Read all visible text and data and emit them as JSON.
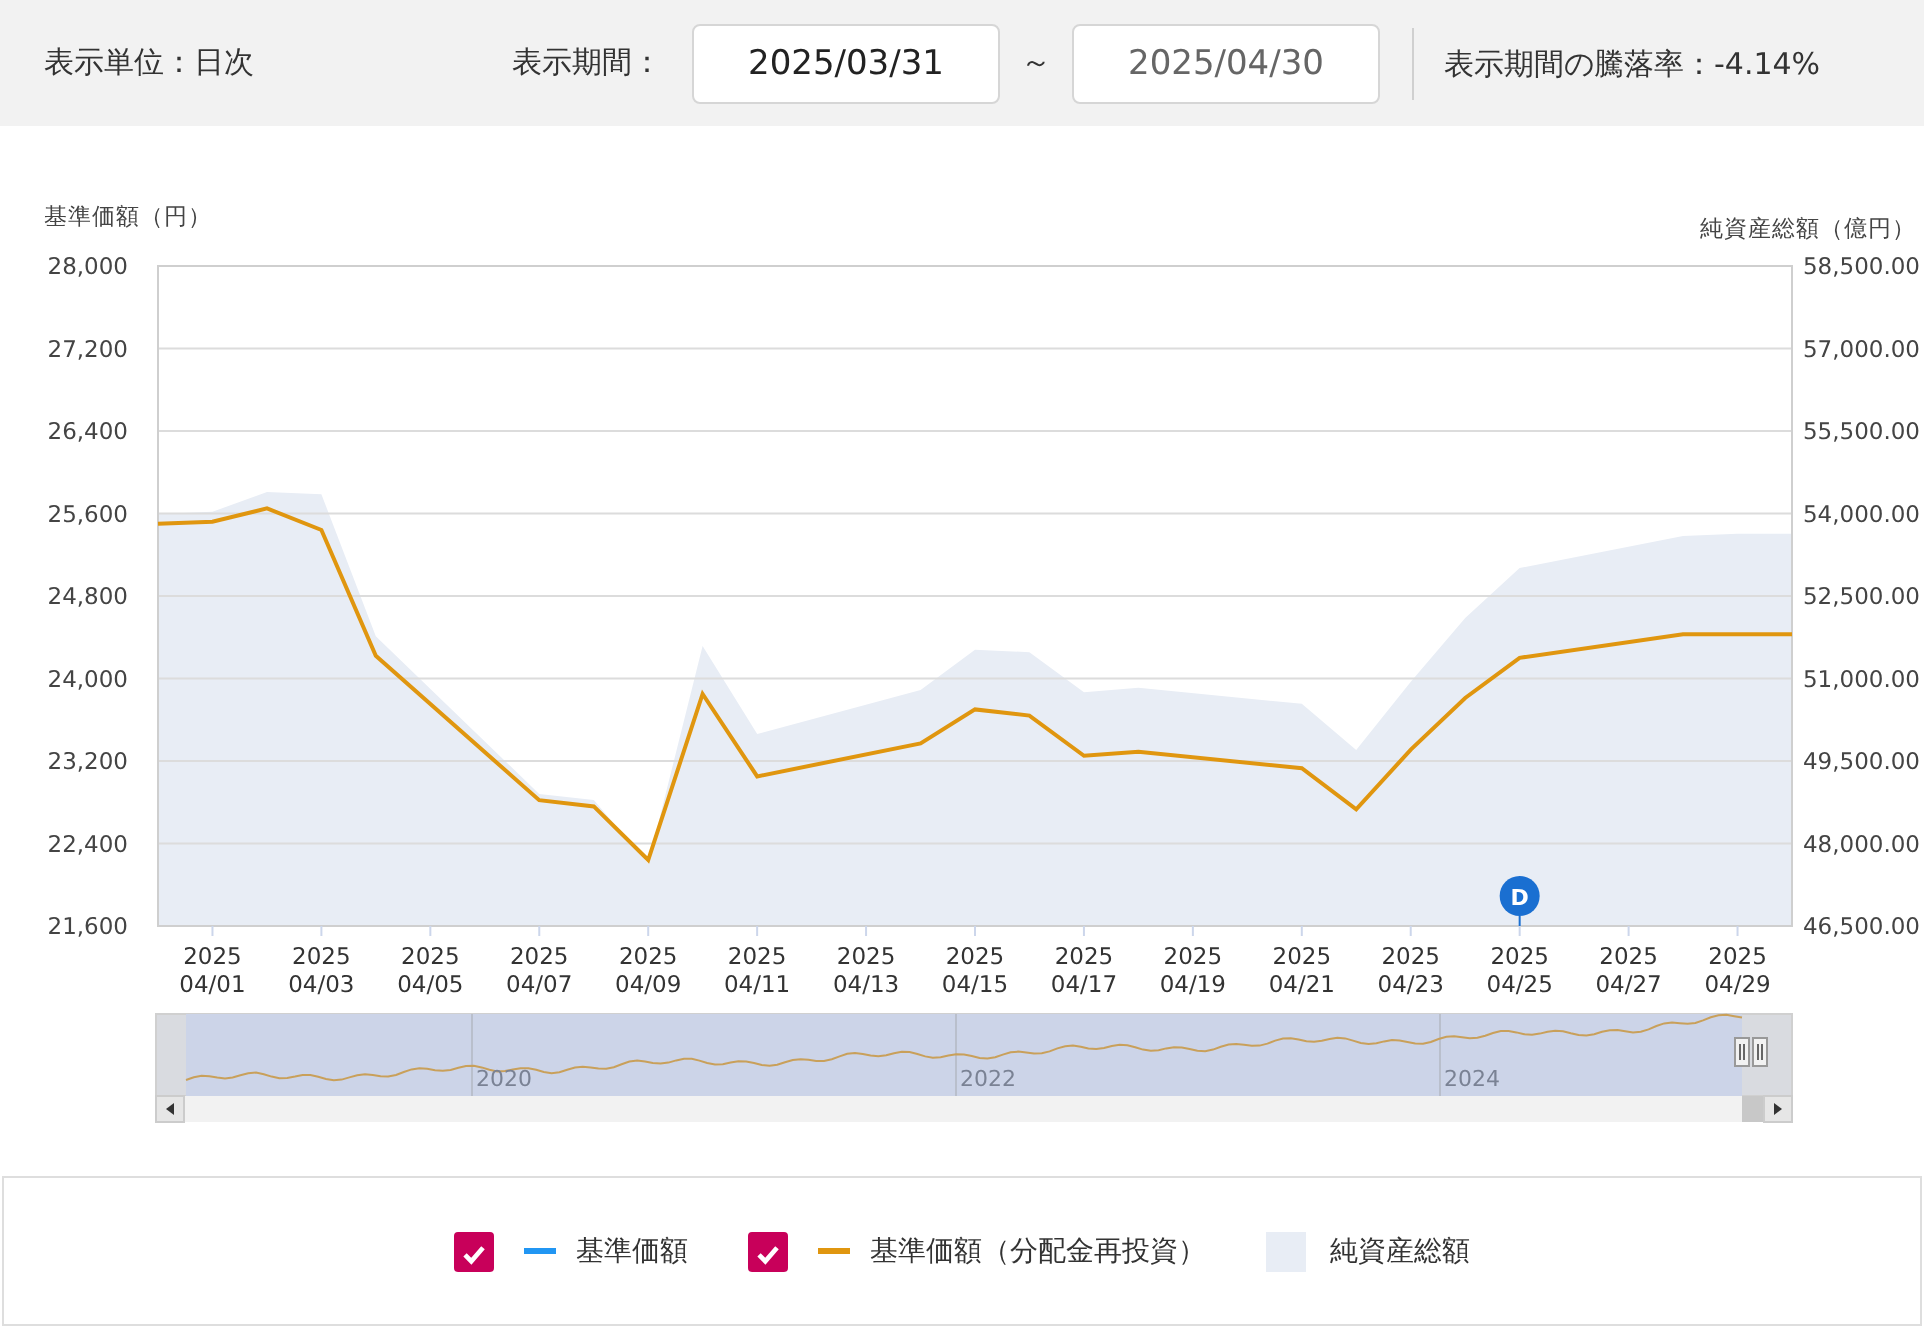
{
  "toolbar": {
    "unit_label": "表示単位：日次",
    "period_label": "表示期間：",
    "start_date": {
      "value": "2025/03/31"
    },
    "separator": "～",
    "end_date": {
      "value": "2025/04/30"
    },
    "change_rate": "表示期間の騰落率：-4.14%"
  },
  "chart": {
    "chart_data": {
      "type": "line",
      "ylabel": "基準価額（円）",
      "y2label": "純資産総額（億円）",
      "categories": [
        null,
        "2025\n04/01",
        null,
        "2025\n04/03",
        null,
        "2025\n04/05",
        null,
        "2025\n04/07",
        null,
        "2025\n04/09",
        null,
        "2025\n04/11",
        null,
        "2025\n04/13",
        null,
        "2025\n04/15",
        null,
        "2025\n04/17",
        null,
        "2025\n04/19",
        null,
        "2025\n04/21",
        null,
        "2025\n04/23",
        null,
        "2025\n04/25",
        null,
        "2025\n04/27",
        null,
        "2025\n04/29",
        null
      ],
      "grid": true,
      "ylim": [
        21600,
        28000
      ],
      "y2lim": [
        46500,
        58500
      ],
      "series": [
        {
          "name": "基準価額",
          "type": "line",
          "color": "#2196f3",
          "values": [
            null,
            null,
            null,
            null,
            null,
            null,
            null,
            null,
            null,
            null,
            null,
            null,
            null,
            null,
            null,
            null,
            null,
            null,
            null,
            null,
            null,
            null,
            null,
            null,
            null,
            null,
            null,
            null,
            null,
            null,
            null
          ]
        },
        {
          "name": "基準価額（分配金再投資）",
          "type": "line",
          "color": "#e0960f",
          "values": [
            25500,
            25520,
            25650,
            25440,
            24220,
            null,
            null,
            22820,
            22760,
            22240,
            23850,
            23050,
            null,
            null,
            23370,
            23700,
            23640,
            23250,
            23290,
            null,
            null,
            23130,
            22730,
            23310,
            23810,
            24200,
            null,
            null,
            24430,
            24430,
            24430
          ]
        },
        {
          "name": "純資産総額",
          "type": "area",
          "axis": "y2",
          "color": "#e8edf5",
          "values": [
            53990,
            54030,
            54390,
            54350,
            51770,
            null,
            null,
            48900,
            48790,
            47630,
            51590,
            49990,
            null,
            null,
            50790,
            51520,
            51480,
            50750,
            50830,
            null,
            null,
            50540,
            49700,
            50940,
            52100,
            53010,
            null,
            null,
            53590,
            53630,
            53630
          ]
        }
      ],
      "yticks": [
        {
          "value": 28000,
          "label": "28,000"
        },
        {
          "value": 27200,
          "label": "27,200"
        },
        {
          "value": 26400,
          "label": "26,400"
        },
        {
          "value": 25600,
          "label": "25,600"
        },
        {
          "value": 24800,
          "label": "24,800"
        },
        {
          "value": 24000,
          "label": "24,000"
        },
        {
          "value": 23200,
          "label": "23,200"
        },
        {
          "value": 22400,
          "label": "22,400"
        },
        {
          "value": 21600,
          "label": "21,600"
        }
      ],
      "y2ticks": [
        {
          "value": 58500,
          "label": "58,500.00"
        },
        {
          "value": 57000,
          "label": "57,000.00"
        },
        {
          "value": 55500,
          "label": "55,500.00"
        },
        {
          "value": 54000,
          "label": "54,000.00"
        },
        {
          "value": 52500,
          "label": "52,500.00"
        },
        {
          "value": 51000,
          "label": "51,000.00"
        },
        {
          "value": 49500,
          "label": "49,500.00"
        },
        {
          "value": 48000,
          "label": "48,000.00"
        },
        {
          "value": 46500,
          "label": "46,500.00"
        }
      ],
      "annotations": [
        {
          "x": "2025\n04/25",
          "text": "D"
        }
      ]
    },
    "navigator": {
      "year_labels": [
        "2020",
        "2022",
        "2024"
      ]
    }
  },
  "legend": [
    {
      "kind": "line",
      "checked": true
    },
    {
      "kind": "line",
      "checked": true
    },
    {
      "kind": "area"
    }
  ]
}
